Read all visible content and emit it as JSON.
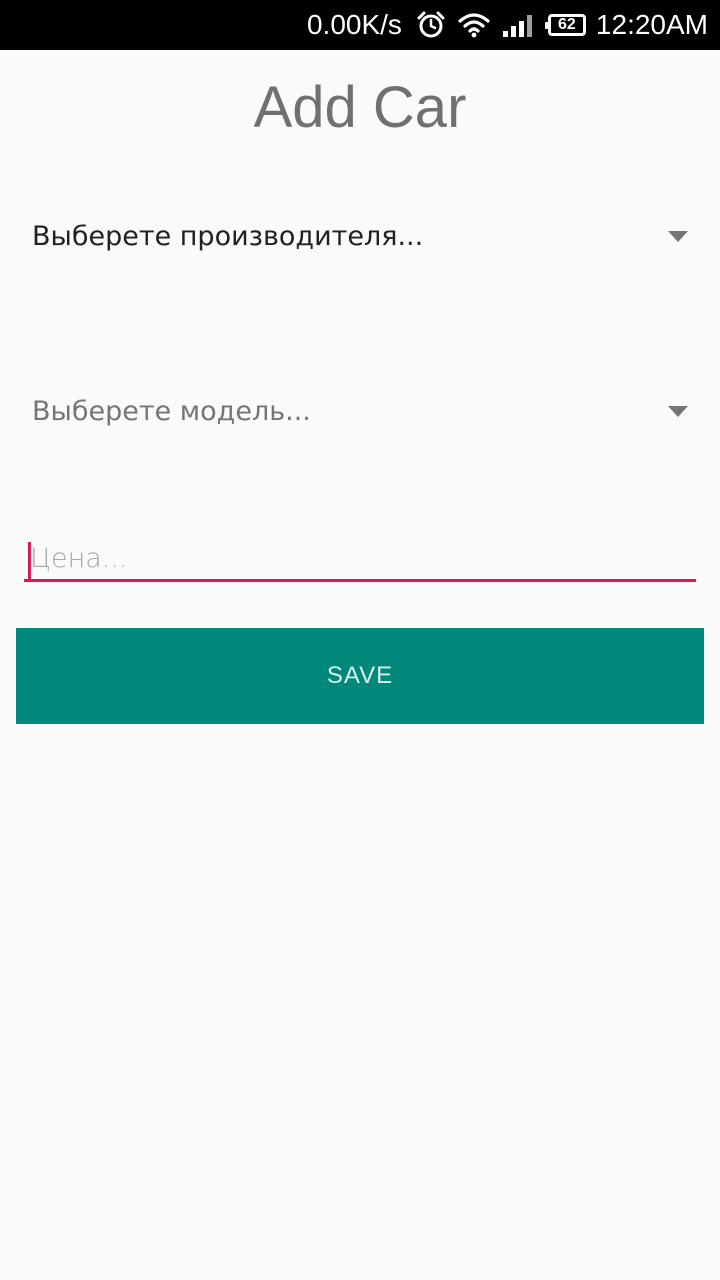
{
  "status_bar": {
    "network_speed": "0.00K/s",
    "battery_level": "62",
    "time": "12:20AM",
    "icons": [
      "alarm-icon",
      "wifi-icon",
      "signal-icon",
      "battery-icon"
    ]
  },
  "page": {
    "title": "Add Car"
  },
  "form": {
    "manufacturer_spinner": {
      "selected_text": "Выберете производителя..."
    },
    "model_spinner": {
      "selected_text": "Выберете модель..."
    },
    "price_input": {
      "value": "",
      "placeholder": "Цена..."
    },
    "save_label": "SAVE"
  },
  "colors": {
    "accent": "#d81b60",
    "button": "#00897b",
    "background": "#fafafa",
    "status_bar": "#000000"
  }
}
